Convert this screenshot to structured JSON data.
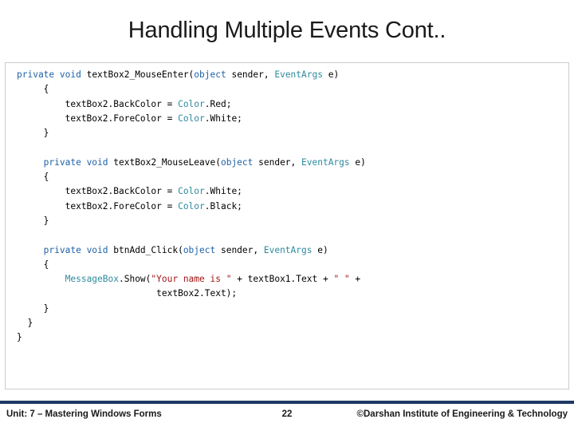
{
  "slide": {
    "title": "Handling Multiple Events Cont..",
    "code_lines": [
      [
        {
          "t": "private ",
          "c": "kw"
        },
        {
          "t": "void ",
          "c": "kw"
        },
        {
          "t": "textBox2_MouseEnter(",
          "c": "ident"
        },
        {
          "t": "object ",
          "c": "kw"
        },
        {
          "t": "sender, ",
          "c": "ident"
        },
        {
          "t": "EventArgs ",
          "c": "teal"
        },
        {
          "t": "e)",
          "c": "ident"
        }
      ],
      [
        {
          "t": "     {",
          "c": "ident"
        }
      ],
      [
        {
          "t": "         textBox2.BackColor = ",
          "c": "ident"
        },
        {
          "t": "Color",
          "c": "teal"
        },
        {
          "t": ".Red;",
          "c": "ident"
        }
      ],
      [
        {
          "t": "         textBox2.ForeColor = ",
          "c": "ident"
        },
        {
          "t": "Color",
          "c": "teal"
        },
        {
          "t": ".White;",
          "c": "ident"
        }
      ],
      [
        {
          "t": "     }",
          "c": "ident"
        }
      ],
      [
        {
          "t": "",
          "c": "ident"
        }
      ],
      [
        {
          "t": "     private ",
          "c": "kw"
        },
        {
          "t": "void ",
          "c": "kw"
        },
        {
          "t": "textBox2_MouseLeave(",
          "c": "ident"
        },
        {
          "t": "object ",
          "c": "kw"
        },
        {
          "t": "sender, ",
          "c": "ident"
        },
        {
          "t": "EventArgs ",
          "c": "teal"
        },
        {
          "t": "e)",
          "c": "ident"
        }
      ],
      [
        {
          "t": "     {",
          "c": "ident"
        }
      ],
      [
        {
          "t": "         textBox2.BackColor = ",
          "c": "ident"
        },
        {
          "t": "Color",
          "c": "teal"
        },
        {
          "t": ".White;",
          "c": "ident"
        }
      ],
      [
        {
          "t": "         textBox2.ForeColor = ",
          "c": "ident"
        },
        {
          "t": "Color",
          "c": "teal"
        },
        {
          "t": ".Black;",
          "c": "ident"
        }
      ],
      [
        {
          "t": "     }",
          "c": "ident"
        }
      ],
      [
        {
          "t": "",
          "c": "ident"
        }
      ],
      [
        {
          "t": "     private ",
          "c": "kw"
        },
        {
          "t": "void ",
          "c": "kw"
        },
        {
          "t": "btnAdd_Click(",
          "c": "ident"
        },
        {
          "t": "object ",
          "c": "kw"
        },
        {
          "t": "sender, ",
          "c": "ident"
        },
        {
          "t": "EventArgs ",
          "c": "teal"
        },
        {
          "t": "e)",
          "c": "ident"
        }
      ],
      [
        {
          "t": "     {",
          "c": "ident"
        }
      ],
      [
        {
          "t": "         ",
          "c": "ident"
        },
        {
          "t": "MessageBox",
          "c": "teal"
        },
        {
          "t": ".Show(",
          "c": "ident"
        },
        {
          "t": "\"Your name is \"",
          "c": "str"
        },
        {
          "t": " + textBox1.Text + ",
          "c": "ident"
        },
        {
          "t": "\" \"",
          "c": "str"
        },
        {
          "t": " +",
          "c": "ident"
        }
      ],
      [
        {
          "t": "                          textBox2.Text);",
          "c": "ident"
        }
      ],
      [
        {
          "t": "     }",
          "c": "ident"
        }
      ],
      [
        {
          "t": "  }",
          "c": "ident"
        }
      ],
      [
        {
          "t": "}",
          "c": "ident"
        }
      ]
    ]
  },
  "footer": {
    "left": "Unit: 7 – Mastering Windows Forms",
    "page": "22",
    "right": "©Darshan Institute of Engineering & Technology"
  }
}
